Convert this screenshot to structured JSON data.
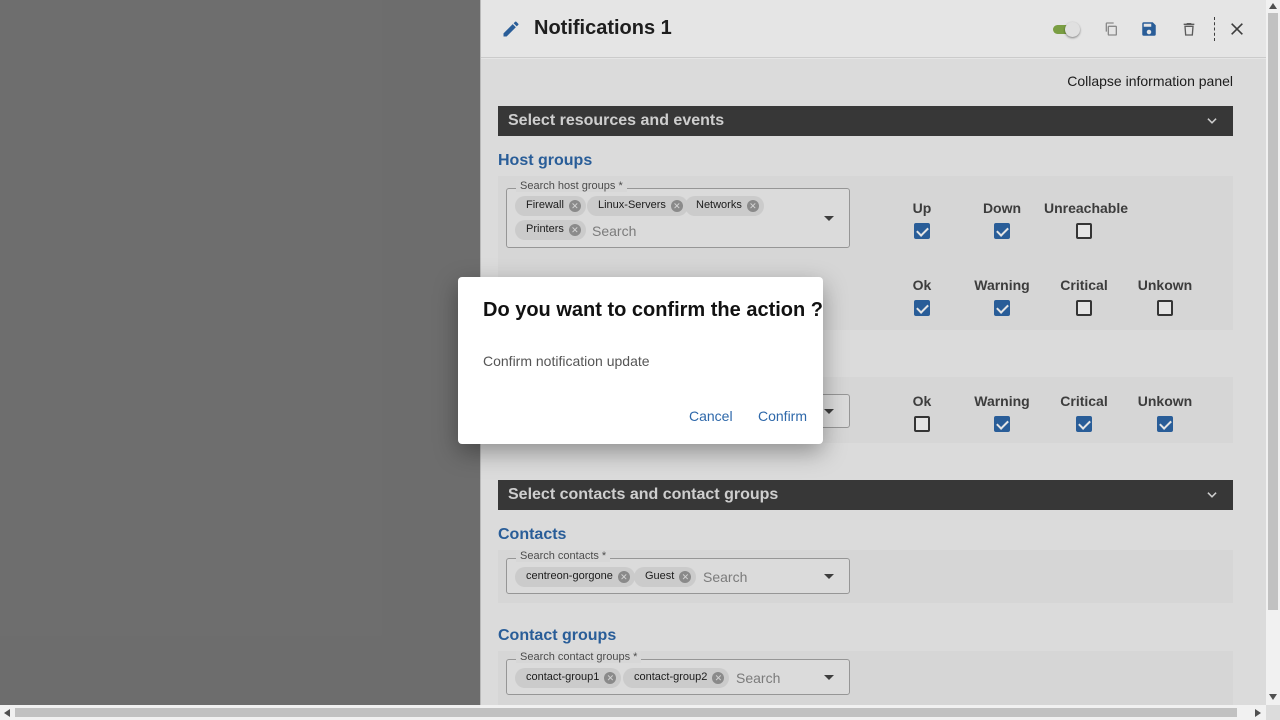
{
  "panel": {
    "title": "Notifications 1",
    "collapse_label": "Collapse information panel"
  },
  "sections": {
    "resources": "Select resources and events",
    "contacts": "Select contacts and contact groups"
  },
  "host_groups": {
    "title": "Host groups",
    "select_label": "Search host groups *",
    "chips": [
      "Firewall",
      "Linux-Servers",
      "Networks",
      "Printers"
    ],
    "search_placeholder": "Search",
    "host_events": [
      {
        "label": "Up",
        "checked": true
      },
      {
        "label": "Down",
        "checked": true
      },
      {
        "label": "Unreachable",
        "checked": false
      }
    ],
    "service_events": [
      {
        "label": "Ok",
        "checked": true
      },
      {
        "label": "Warning",
        "checked": true
      },
      {
        "label": "Critical",
        "checked": false
      },
      {
        "label": "Unkown",
        "checked": false
      }
    ]
  },
  "service_groups": {
    "service_events": [
      {
        "label": "Ok",
        "checked": false
      },
      {
        "label": "Warning",
        "checked": true
      },
      {
        "label": "Critical",
        "checked": true
      },
      {
        "label": "Unkown",
        "checked": true
      }
    ]
  },
  "contacts": {
    "title": "Contacts",
    "select_label": "Search contacts *",
    "chips": [
      "centreon-gorgone",
      "Guest"
    ],
    "search_placeholder": "Search"
  },
  "contact_groups": {
    "title": "Contact groups",
    "select_label": "Search contact groups *",
    "chips": [
      "contact-group1",
      "contact-group2"
    ],
    "search_placeholder": "Search"
  },
  "dialog": {
    "title": "Do you want to confirm the action ?",
    "text": "Confirm notification update",
    "cancel": "Cancel",
    "confirm": "Confirm"
  },
  "colors": {
    "accent": "#2e68aa",
    "section_bar": "#3e3e3e",
    "toggle_on": "#88b04b"
  },
  "icons": {
    "edit": "pencil-icon",
    "toggle": "toggle-switch",
    "duplicate": "copy-icon",
    "save": "floppy-disk-icon",
    "delete": "trash-icon",
    "close": "close-icon"
  }
}
